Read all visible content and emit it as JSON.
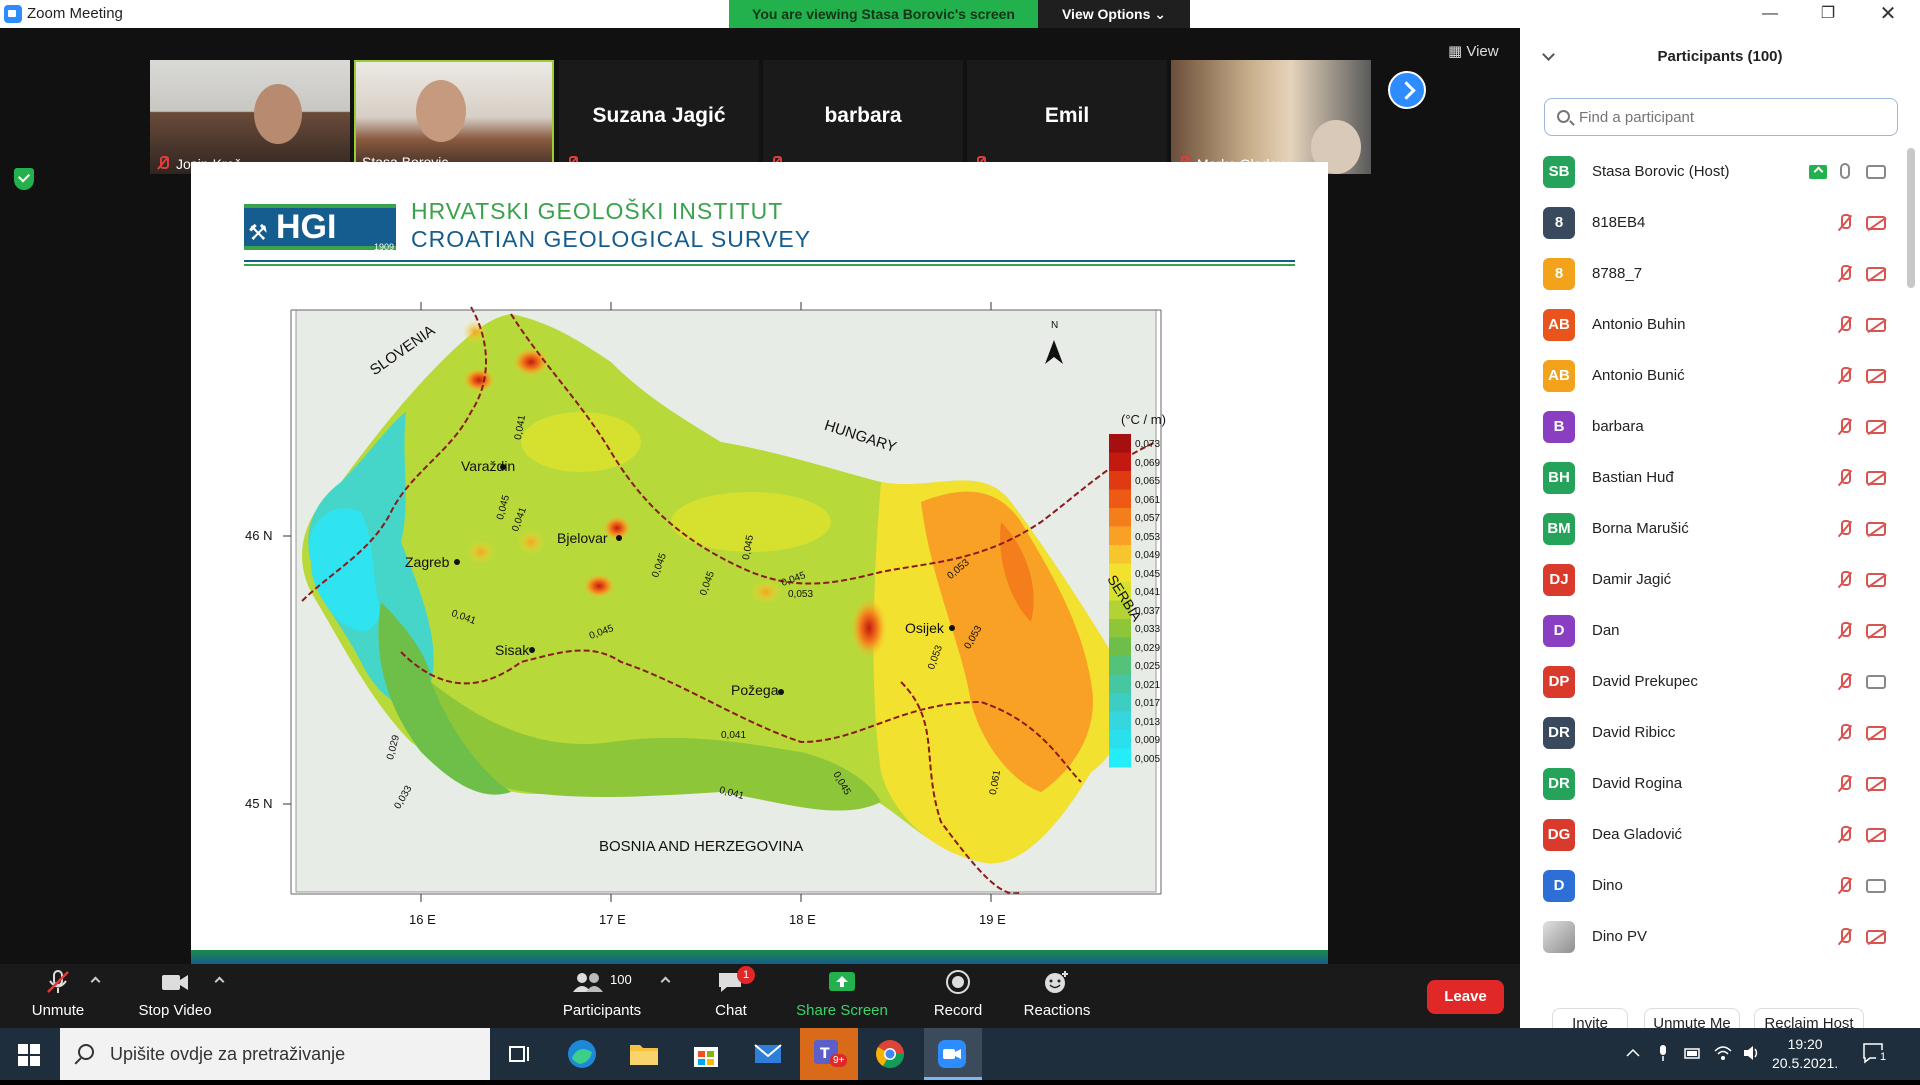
{
  "window": {
    "title": "Zoom Meeting"
  },
  "banner": {
    "viewing": "You are viewing Stasa Borovic's screen",
    "view_options": "View Options"
  },
  "videos": [
    {
      "name": "Josip Kraš",
      "has_video": true
    },
    {
      "name": "Stasa Borovic",
      "has_video": true
    },
    {
      "name": "Suzana Jagić",
      "has_video": false
    },
    {
      "name": "barbara",
      "has_video": false
    },
    {
      "name": "Emil",
      "has_video": false
    },
    {
      "name": "Marko Gladov...",
      "has_video": true
    }
  ],
  "view_button": "View",
  "slide": {
    "logo": "HGI",
    "logo_year": "1909",
    "institute_hr": "HRVATSKI GEOLOŠKI INSTITUT",
    "institute_en": "CROATIAN GEOLOGICAL SURVEY",
    "map": {
      "unit": "(°C / m)",
      "north": "N",
      "countries": [
        "SLOVENIA",
        "HUNGARY",
        "SERBIA",
        "BOSNIA AND HERZEGOVINA"
      ],
      "cities": [
        "Varaždin",
        "Zagreb",
        "Bjelovar",
        "Sisak",
        "Osijek",
        "Požega"
      ],
      "lat_ticks": [
        "46 N",
        "45 N"
      ],
      "lon_ticks": [
        "16 E",
        "17 E",
        "18 E",
        "19 E"
      ],
      "contours": [
        "0,041",
        "0,045",
        "0,045",
        "0,045",
        "0,045",
        "0,053",
        "0,053",
        "0,053",
        "0,041",
        "0,045",
        "0,045",
        "0,041",
        "0,041",
        "0,029",
        "0,033",
        "0,041",
        "0,045",
        "0,053",
        "0,061"
      ],
      "legend": [
        "0,073",
        "0,069",
        "0,065",
        "0,061",
        "0,057",
        "0,053",
        "0,049",
        "0,045",
        "0,041",
        "0,037",
        "0,033",
        "0,029",
        "0,025",
        "0,021",
        "0,017",
        "0,013",
        "0,009",
        "0,005"
      ],
      "legend_colors": [
        "#a50f0f",
        "#c21a10",
        "#df3a12",
        "#ee5a14",
        "#f57e1c",
        "#f8a125",
        "#f7c52c",
        "#f2e12f",
        "#d5e02f",
        "#b3d334",
        "#8ec63a",
        "#6ebf4a",
        "#55c27a",
        "#45c7a1",
        "#3ecdc3",
        "#35d6dd",
        "#2be0ed",
        "#24ecf9"
      ]
    }
  },
  "participants": {
    "header": "Participants (100)",
    "search_placeholder": "Find a participant",
    "list": [
      {
        "initials": "SB",
        "name": "Stasa Borovic (Host)",
        "color": "#26a35a",
        "mic": "on",
        "cam": "on",
        "sharing": true
      },
      {
        "initials": "8",
        "name": "818EB4",
        "color": "#394a5e",
        "mic": "off",
        "cam": "off"
      },
      {
        "initials": "8",
        "name": "8788_7",
        "color": "#f2a21b",
        "mic": "off",
        "cam": "off"
      },
      {
        "initials": "AB",
        "name": "Antonio Buhin",
        "color": "#e8541b",
        "mic": "off",
        "cam": "off"
      },
      {
        "initials": "AB",
        "name": "Antonio Bunić",
        "color": "#f2a21b",
        "mic": "off",
        "cam": "off"
      },
      {
        "initials": "B",
        "name": "barbara",
        "color": "#8a3fc2",
        "mic": "off",
        "cam": "off"
      },
      {
        "initials": "BH",
        "name": "Bastian Huđ",
        "color": "#26a35a",
        "mic": "off",
        "cam": "off"
      },
      {
        "initials": "BM",
        "name": "Borna Marušić",
        "color": "#26a35a",
        "mic": "off",
        "cam": "off"
      },
      {
        "initials": "DJ",
        "name": "Damir Jagić",
        "color": "#d93a2b",
        "mic": "off",
        "cam": "off"
      },
      {
        "initials": "D",
        "name": "Dan",
        "color": "#8a3fc2",
        "mic": "off",
        "cam": "off"
      },
      {
        "initials": "DP",
        "name": "David Prekupec",
        "color": "#d93a2b",
        "mic": "off",
        "cam": "on"
      },
      {
        "initials": "DR",
        "name": "David Ribicc",
        "color": "#394a5e",
        "mic": "off",
        "cam": "off"
      },
      {
        "initials": "DR",
        "name": "David Rogina",
        "color": "#26a35a",
        "mic": "off",
        "cam": "off"
      },
      {
        "initials": "DG",
        "name": "Dea Gladović",
        "color": "#d93a2b",
        "mic": "off",
        "cam": "off"
      },
      {
        "initials": "D",
        "name": "Dino",
        "color": "#2d6fd6",
        "mic": "off",
        "cam": "on"
      },
      {
        "initials": "",
        "name": "Dino PV",
        "color": "#a9a9a9",
        "mic": "off",
        "cam": "off"
      }
    ],
    "buttons": {
      "invite": "Invite",
      "unmute_me": "Unmute Me",
      "reclaim_host": "Reclaim Host"
    }
  },
  "toolbar": {
    "unmute": "Unmute",
    "stop_video": "Stop Video",
    "participants": "Participants",
    "participants_count": "100",
    "chat": "Chat",
    "chat_badge": "1",
    "share_screen": "Share Screen",
    "record": "Record",
    "reactions": "Reactions",
    "leave": "Leave"
  },
  "taskbar": {
    "search_placeholder": "Upišite ovdje za pretraživanje",
    "teams_badge": "9+",
    "time": "19:20",
    "date": "20.5.2021.",
    "notifications": "1"
  }
}
